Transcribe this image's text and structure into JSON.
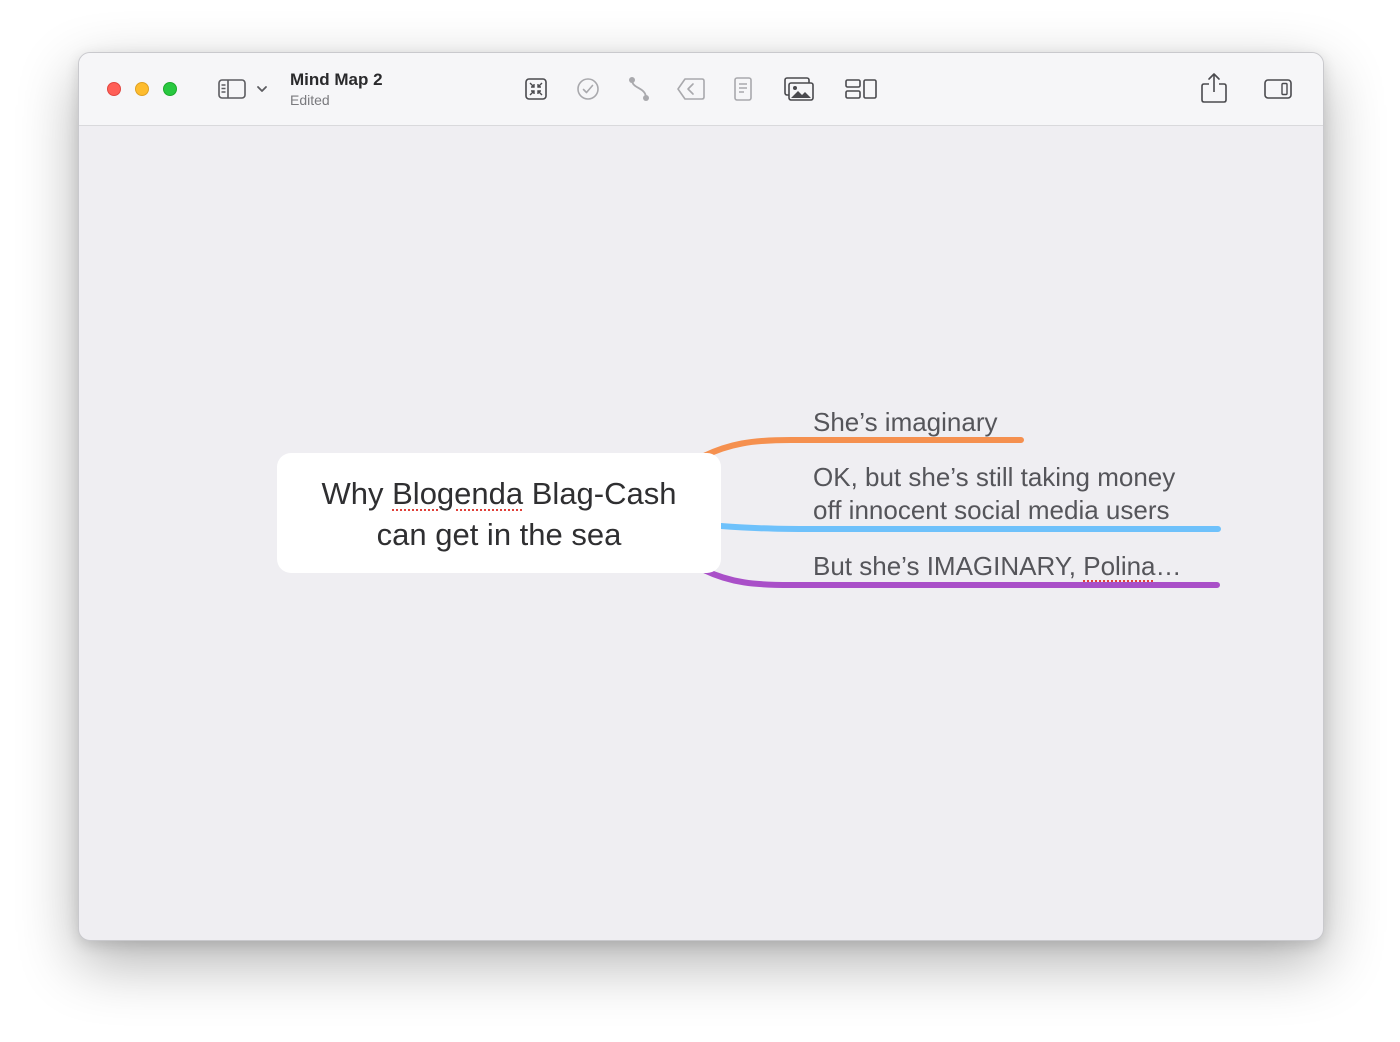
{
  "window": {
    "title": "Mind Map 2",
    "subtitle": "Edited"
  },
  "toolbar": {
    "left_icons": [
      "sidebar-icon",
      "chevron-down-icon"
    ],
    "center_icons": [
      "focus-icon",
      "task-checkmark-icon",
      "connection-icon",
      "collapse-icon",
      "notes-icon",
      "image-icon",
      "outline-icon"
    ],
    "right_icons": [
      "share-icon",
      "inspector-icon"
    ]
  },
  "mindmap": {
    "central_topic": {
      "line1_before": "Why ",
      "line1_misspelled": "Blogenda",
      "line1_after": " Blag-Cash",
      "line2": "can get in the sea"
    },
    "branches": [
      {
        "lines": [
          "She’s imaginary"
        ],
        "color": "#f5904f"
      },
      {
        "lines": [
          "OK, but she’s still taking money",
          "off innocent social media users"
        ],
        "color": "#6ec1fb"
      },
      {
        "text_before": "But she’s IMAGINARY, ",
        "text_misspelled": "Polina",
        "text_after": "…",
        "color": "#a94fc8"
      }
    ]
  },
  "colors": {
    "canvas_background": "#efeef2",
    "titlebar_background": "#f6f6f8",
    "traffic_close": "#ff5f57",
    "traffic_minimize": "#febc2e",
    "traffic_maximize": "#28c840",
    "spellcheck_underline": "#e0403a"
  }
}
